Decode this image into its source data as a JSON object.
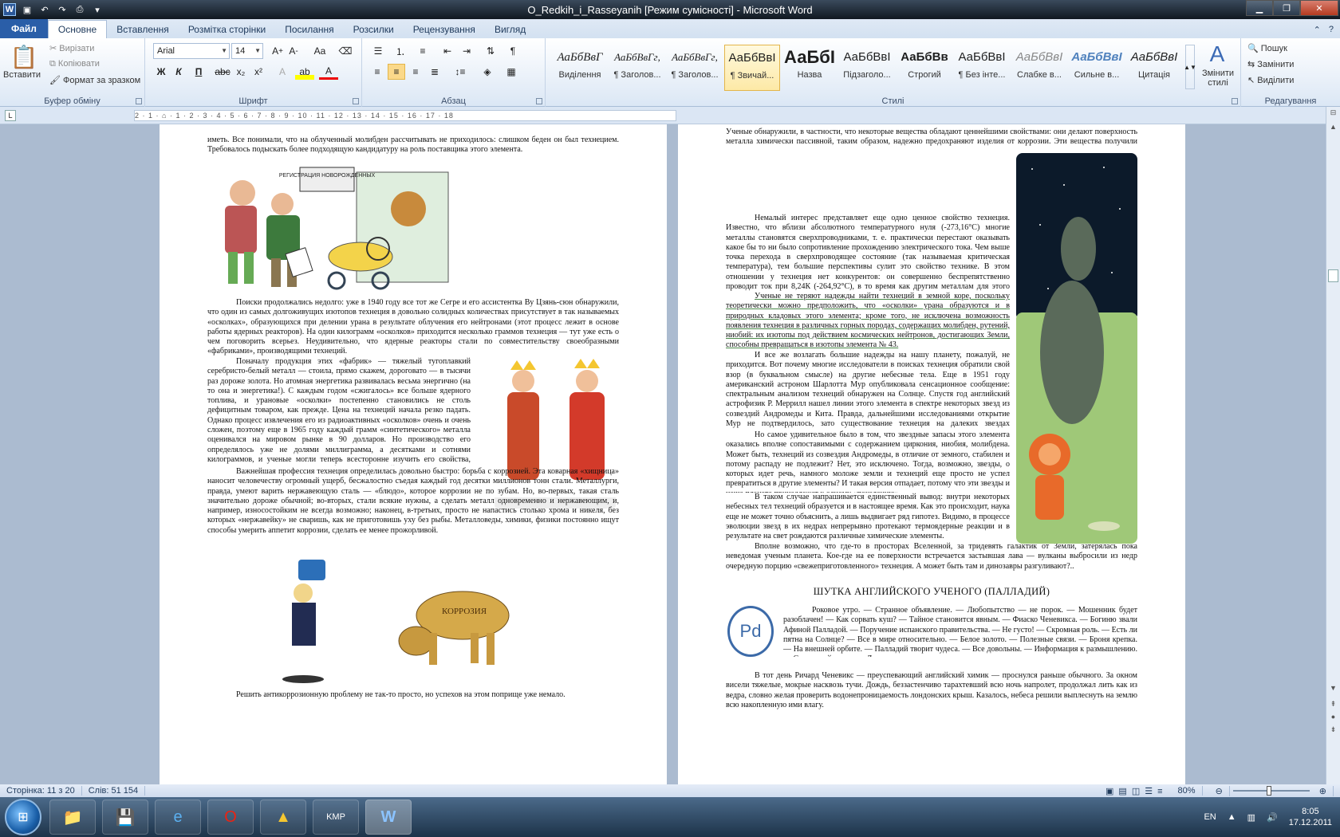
{
  "window": {
    "title": "O_Redkih_i_Rasseyanih [Режим сумісності]  -  Microsoft Word"
  },
  "tabs": [
    {
      "label": "Файл"
    },
    {
      "label": "Основне"
    },
    {
      "label": "Вставлення"
    },
    {
      "label": "Розмітка сторінки"
    },
    {
      "label": "Посилання"
    },
    {
      "label": "Розсилки"
    },
    {
      "label": "Рецензування"
    },
    {
      "label": "Вигляд"
    }
  ],
  "clipboard": {
    "paste": "Вставити",
    "cut": "Вирізати",
    "copy": "Копіювати",
    "format_painter": "Формат за зразком",
    "group": "Буфер обміну"
  },
  "font": {
    "name": "Arial",
    "size": "14",
    "group": "Шрифт"
  },
  "paragraph": {
    "group": "Абзац"
  },
  "styles": {
    "group": "Стилі",
    "items": [
      {
        "sample": "АаБбВвГ",
        "name": "Виділення"
      },
      {
        "sample": "АаБбВвГг,",
        "name": "¶ Заголов..."
      },
      {
        "sample": "АаБбВвГг,",
        "name": "¶ Заголов..."
      },
      {
        "sample": "АаБбВвІ",
        "name": "¶ Звичай..."
      },
      {
        "sample": "АаБбІ",
        "name": "Назва"
      },
      {
        "sample": "АаБбВвІ",
        "name": "Підзаголо..."
      },
      {
        "sample": "АаБбВв",
        "name": "Строгий"
      },
      {
        "sample": "АаБбВвІ",
        "name": "¶ Без інте..."
      },
      {
        "sample": "АаБбВвІ",
        "name": "Слабке в..."
      },
      {
        "sample": "АаБбВвІ",
        "name": "Сильне в..."
      },
      {
        "sample": "АаБбВвІ",
        "name": "Цитація"
      }
    ],
    "change": "Змінити стилі"
  },
  "editing": {
    "group": "Редагування",
    "find": "Пошук",
    "replace": "Замінити",
    "select": "Виділити"
  },
  "ruler": {
    "ticks": "2 · 1 · ⌂ · 1 · 2 · 3 · 4 · 5 · 6 · 7 · 8 · 9 · 10 · 11 · 12 · 13 · 14 · 15 · 16 · 17 · 18"
  },
  "page1": {
    "p_top": "иметь. Все понимали, что на облученный молибден рассчитывать не приходилось: слишком беден он был технецием. Требовалось подыскать более подходящую кандидатуру на роль поставщика этого элемента.",
    "p_search": "Поиски продолжались недолго: уже в 1940 году все тот же Сегре и его ассистентка Ву Цзянь-сюн обнаружили, что один из самых долгоживущих изотопов технеция в довольно солидных количествах присутствует в так называемых «осколках», образующихся при делении урана в результате облучения его нейтронами (этот процесс лежит в основе работы ядерных реакторов). На один килограмм «осколков» приходится несколько граммов технеция — тут уже есть о чем поговорить всерьез. Неудивительно, что ядерные реакторы стали по совместительству своеобразными «фабриками», производящими технеций.",
    "p_production": "Поначалу продукция этих «фабрик» — тяжелый тугоплавкий серебристо-белый металл — стоила, прямо скажем, дороговато — в тысячи раз дороже золота. Но атомная энергетика развивалась весьма энергично (на то она и энергетика!). С каждым годом «сжигалось» все больше ядерного топлива, и урановые «осколки» постепенно становились не столь дефицитным товаром, как прежде. Цена на технеций начала резко падать. Однако процесс извлечения его из радиоактивных «осколков» очень и очень сложен, поэтому еще в 1965 году каждый грамм «синтетического» металла оценивался на мировом рынке в 90 долларов. Но производство его определялось уже не долями миллиграмма, а десятками и сотнями килограммов, и ученые могли теперь всесторонне изучить его свойства, попытаться определить возможные сферы его будущей деятельности.",
    "p_profession": "Важнейшая профессия технеция определилась довольно быстро: борьба с коррозией. Эта коварная «хищница» наносит человечеству огромный ущерб, бесжалостно съедая каждый год десятки миллионов тонн стали. Металлурги, правда, умеют варить нержавеющую сталь — «блюдо», которое коррозии не по зубам. Но, во-первых, такая сталь значительно дороже обычной; во-вторых, стали всякие нужны, а сделать металл одновременно и нержавеющим, и, например, износостойким не всегда возможно; наконец, в-третьих, просто не напастись столько хрома и никеля, без которых «нержавейку» не сваришь, как не приготовишь уху без рыбы. Металловеды, химики, физики постоянно ищут способы умерить аппетит коррозии, сделать ее менее прожорливой.",
    "p_bottom": "Решить антикоррозионную проблему не так-то просто, но успехов на этом поприще уже немало.",
    "sign_text": "РЕГИСТРАЦИЯ НОВОРОЖДЕННЫХ",
    "bull_text": "КОРРОЗИЯ"
  },
  "page2": {
    "p_scientists": "Ученые обнаружили, в частности, что некоторые вещества обладают ценнейшими свойствами: они делают поверхность металла химически пассивной, таким образом, надежно предохраняют изделия от коррозии. Эти вещества получили название ингибиторов (от латинского слова «ингибире» — тормозить, удерживать). Самым способным из них оказался технеций: он обладает наибольшим ингибирующим эффектом. Если стальную деталь обработать раствором, в котором присутствуют едва уловимые количества пертехнатов (солей технециевой кислоты) — всего стотысячные доли процента, то она окажется неприступной крепостью для ржавчины. Даже значительный нагрев (до 250°С) не в силах при этом помочь «агрессору».",
    "p_interest": "Немалый интерес представляет еще одно ценное свойство технеция. Известно, что вблизи абсолютного температурного нуля (-273,16°С) многие металлы становятся сверхпроводниками, т. е. практически перестают оказывать какое бы то ни было сопротивление прохождению электрического тока. Чем выше точка перехода в сверхпроводящее состояние (так называемая критическая температура), тем большие перспективы сулит это свойство технике. В этом отношении у технеция нет конкурентов: он совершенно беспрепятственно проводит ток при 8,24К (-264,92°С), в то время как другим металлам для этого нужно еще немного «поостыть».",
    "p_search": "Ученые не теряют надежды найти технеций в земной коре, поскольку теоретически можно предположить, что «осколки» урана образуются и в природных кладовых этого элемента; кроме того, не исключена возможность появления технеция в различных горных породах, содержащих молибден, рутений, ниобий: их изотопы под действием космических нейтронов, достигающих Земли, способны превращаться в изотопы элемента № 43.",
    "p_hopes": "И все же возлагать большие надежды на нашу планету, пожалуй, не приходится. Вот почему многие исследователи в поисках технеция обратили свой взор (в буквальном смысле) на другие небесные тела. Еще в 1951 году американский астроном Шарлотта Мур опубликовала сенсационное сообщение: спектральным анализом технеций обнаружен на Солнце. Спустя год английский астрофизик Р. Меррилл нашел линии этого элемента в спектре некоторых звезд из созвездий Андромеды и Кита. Правда, дальнейшими исследованиями открытие Мур не подтвердилось, зато существование технеция на далеких звездах неопровержимо доказывали сотни спектрограмм.",
    "p_surprise": "Но самое удивительное было в том, что звездные запасы этого элемента оказались вполне сопоставимыми с содержанием циркония, ниобия, молибдена. Может быть, технеций из созвездия Андромеды, в отличие от земного, стабилен и потому распаду не подлежит? Нет, это исключено. Тогда, возможно, звезды, о которых идет речь, намного моложе земли и технеций еще просто не успел превратиться в другие элементы? И такая версия отпадает, потому что эти звезды и наша планета принадлежат к одному «поколению».",
    "p_conclusion": "В таком случае напрашивается единственный вывод: внутри некоторых небесных тел технеций образуется и в настоящее время. Как это происходит, наука еще не может точно объяснить, а лишь выдвигает ряд гипотез. Видимо, в процессе эволюции звезд в их недрах непрерывно протекают термоядерные реакции и в результате на свет рождаются различные химические элементы.",
    "p_planet": "Вполне возможно, что где-то в просторах Вселенной, за тридевять галактик от Земли, затерялась пока неведомая ученым планета. Кое-где на ее поверхности встречается застывшая лава — вулканы выбросили из недр очередную порцию «свежеприготовленного» технеция. А может быть там и динозавры разгуливают?..",
    "heading": "ШУТКА АНГЛИЙСКОГО УЧЕНОГО (ПАЛЛАДИЙ)",
    "pd_symbol": "Pd",
    "p_contents": "Роковое утро. — Странное объявление. — Любопытство — не порок. — Мошенник будет разоблачен! — Как сорвать куш? — Тайное становится явным. — Фиаско Ченевикса. — Богиню звали Афиной Палладой. — Поручение испанского правительства. — Не густо! — Скромная роль. — Есть ли пятна на Солнце? — Все в мире относительно. — Белое золото. — Полезные связи. — Броня крепка. — На внешней орбите. — Палладий творит чудеса. — Все довольны. — Информация к размышлению. — Сиреневый сплав. — Две медали.",
    "p_chenevix": "В тот день Ричард Ченевикс — преуспевающий английский химик — проснулся раньше обычного. За окном висели тяжелые, мокрые насквозь тучи. Дождь, беззастенчиво тарахтевший всю ночь напролет, продолжал лить как из ведра, словно желая проверить водонепроницаемость лондонских крыш. Казалось, небеса решили выплеснуть на землю всю накопленную ими влагу."
  },
  "status": {
    "page": "Сторінка: 11 з 20",
    "words": "Слів: 51 154",
    "zoom": "80%"
  },
  "taskbar": {
    "lang": "EN",
    "time": "8:05",
    "date": "17.12.2011"
  }
}
